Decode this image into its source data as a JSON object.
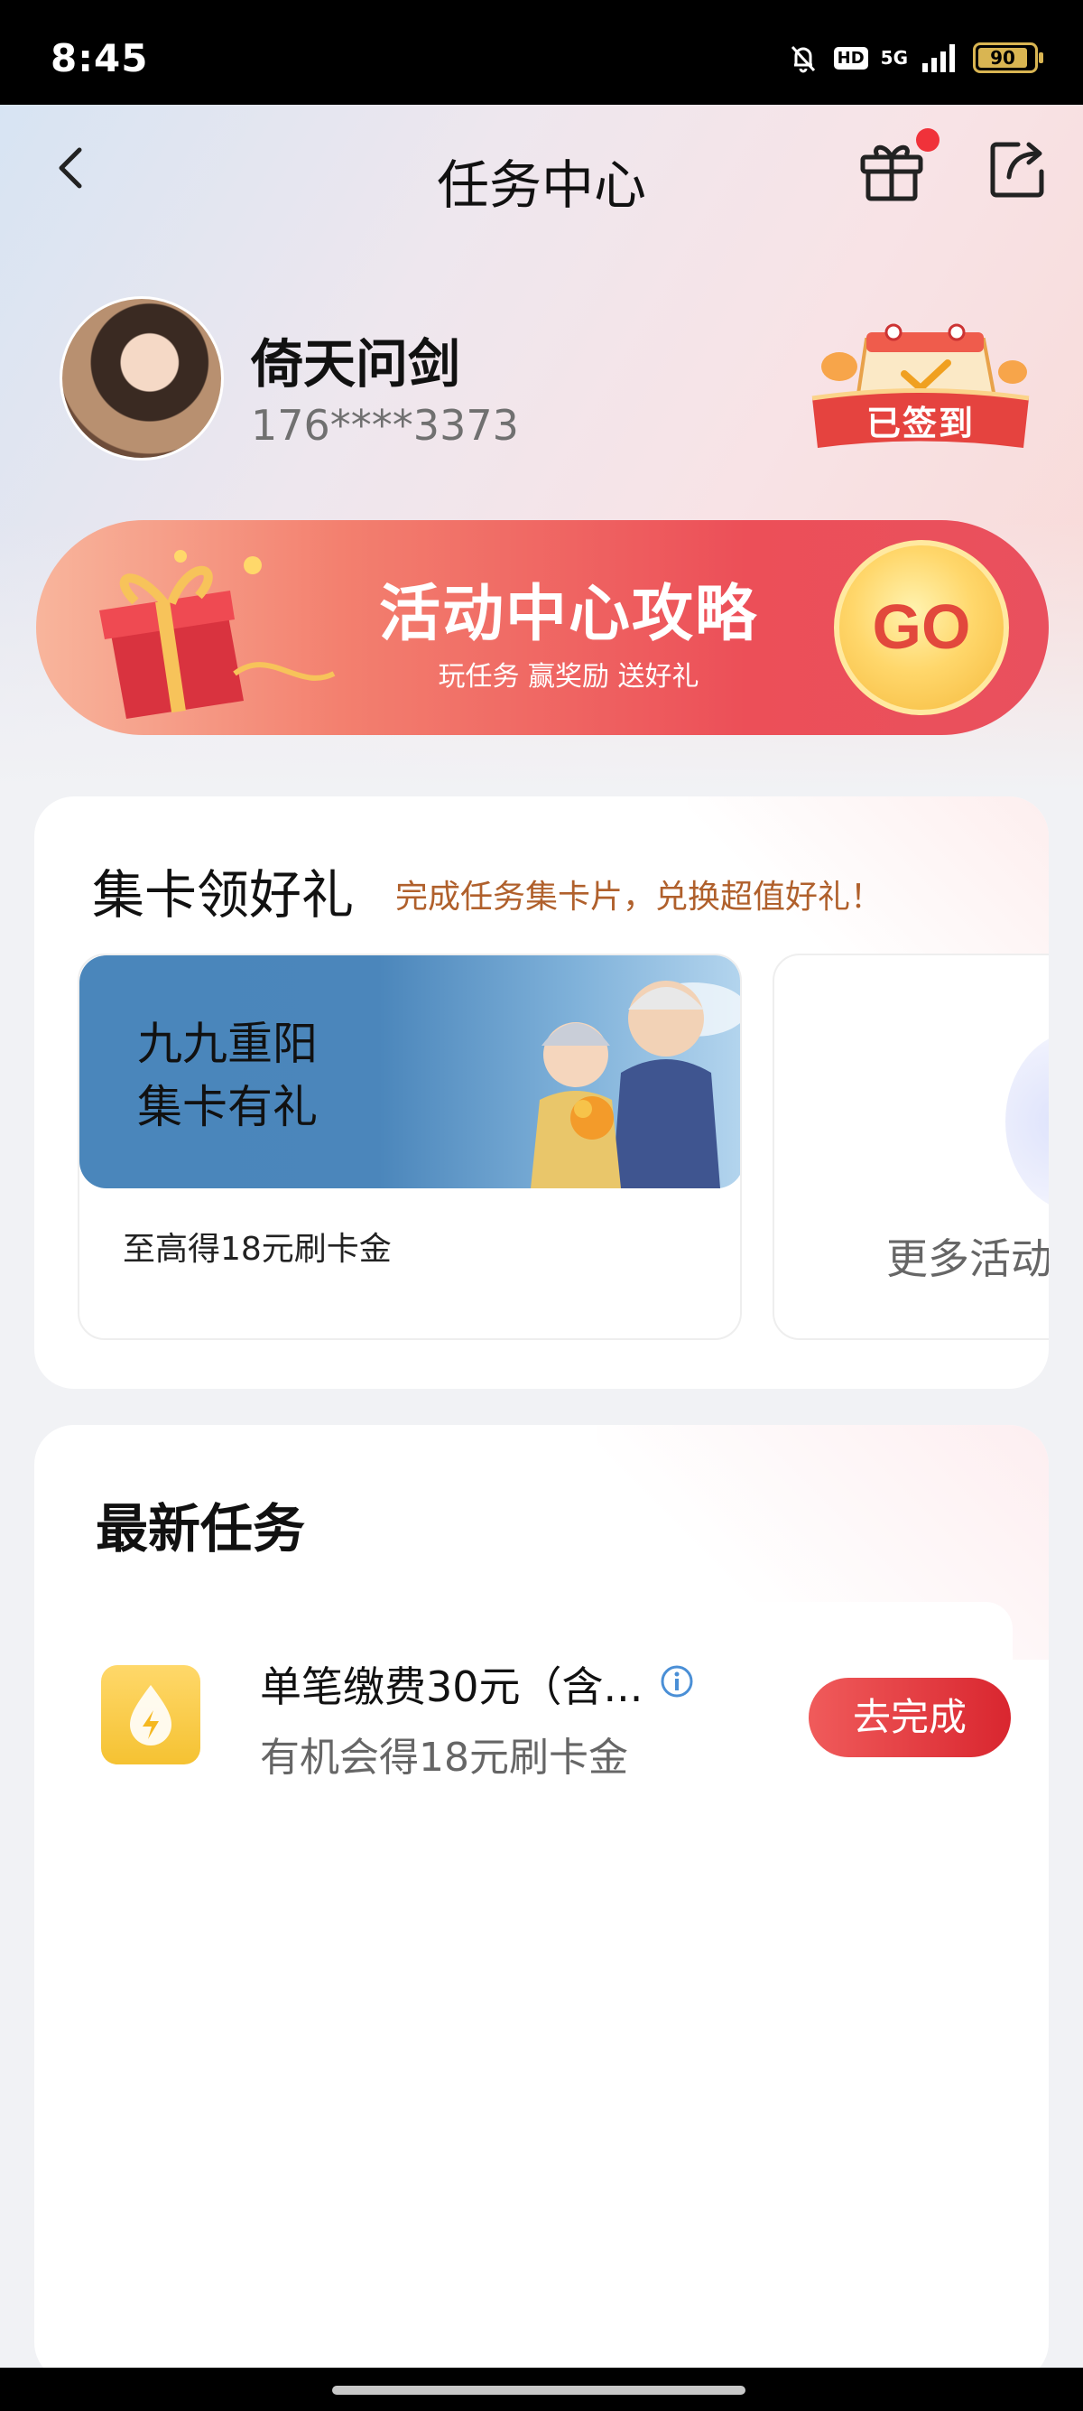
{
  "status_bar": {
    "time": "8:45",
    "hd": "HD",
    "network": "5G",
    "battery": "90"
  },
  "nav": {
    "title": "任务中心",
    "icons": [
      "back-icon",
      "gift-icon",
      "share-icon"
    ],
    "notification_dot_color": "#f0323a"
  },
  "profile": {
    "name": "倚天问剑",
    "phone": "176****3373",
    "sign_badge": "已签到"
  },
  "banner": {
    "title": "活动中心攻略",
    "subtitle": "玩任务 赢奖励 送好礼",
    "go_label": "GO"
  },
  "card_section": {
    "title": "集卡领好礼",
    "subtitle": "完成任务集卡片，兑换超值好礼！",
    "activity": {
      "line1": "九九重阳",
      "line2": "集卡有礼",
      "caption": "至高得18元刷卡金"
    },
    "more_label": "更多活动"
  },
  "task_section": {
    "title": "最新任务",
    "tasks": [
      {
        "name": "单笔缴费30元（含...",
        "reward": "有机会得18元刷卡金",
        "button": "去完成"
      }
    ]
  },
  "colors": {
    "accent_red": "#e0303a",
    "subtitle_brown": "#b0602c",
    "task_icon_yellow": "#f5c232"
  }
}
